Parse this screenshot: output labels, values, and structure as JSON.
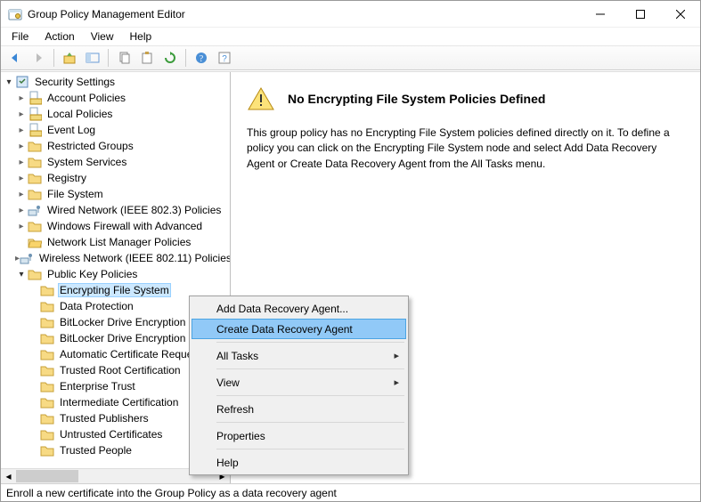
{
  "window": {
    "title": "Group Policy Management Editor"
  },
  "menubar": [
    "File",
    "Action",
    "View",
    "Help"
  ],
  "toolbar_icons": [
    "back-arrow-icon",
    "forward-arrow-icon",
    "up-folder-icon",
    "show-hide-tree-icon",
    "copy-icon",
    "paste-icon",
    "refresh-icon",
    "help-blue-icon",
    "help-toggle-icon"
  ],
  "tree": {
    "root": {
      "label": "Security Settings"
    },
    "nodes": [
      {
        "label": "Account Policies",
        "icon": "policy"
      },
      {
        "label": "Local Policies",
        "icon": "policy"
      },
      {
        "label": "Event Log",
        "icon": "policy"
      },
      {
        "label": "Restricted Groups",
        "icon": "folder"
      },
      {
        "label": "System Services",
        "icon": "folder"
      },
      {
        "label": "Registry",
        "icon": "folder"
      },
      {
        "label": "File System",
        "icon": "folder"
      },
      {
        "label": "Wired Network (IEEE 802.3) Policies",
        "icon": "net"
      },
      {
        "label": "Windows Firewall with Advanced",
        "icon": "folder"
      },
      {
        "label": "Network List Manager Policies",
        "icon": "folder-open"
      },
      {
        "label": "Wireless Network (IEEE 802.11) Policies",
        "icon": "net"
      }
    ],
    "pkp": {
      "label": "Public Key Policies"
    },
    "pkp_children": [
      {
        "label": "Encrypting File System",
        "selected": true
      },
      {
        "label": "Data Protection"
      },
      {
        "label": "BitLocker Drive Encryption"
      },
      {
        "label": "BitLocker Drive Encryption Network"
      },
      {
        "label": "Automatic Certificate Request"
      },
      {
        "label": "Trusted Root Certification"
      },
      {
        "label": "Enterprise Trust"
      },
      {
        "label": "Intermediate Certification"
      },
      {
        "label": "Trusted Publishers"
      },
      {
        "label": "Untrusted Certificates"
      },
      {
        "label": "Trusted People"
      }
    ]
  },
  "content": {
    "heading": "No Encrypting File System Policies Defined",
    "body": "This group policy has no Encrypting File System policies defined directly on it.  To define a policy you can click on the Encrypting File System node and select Add Data Recovery Agent or Create Data Recovery Agent from the All Tasks menu."
  },
  "context_menu": {
    "items": [
      {
        "label": "Add Data Recovery Agent...",
        "type": "item"
      },
      {
        "label": "Create Data Recovery Agent",
        "type": "item",
        "hover": true
      },
      {
        "type": "sep"
      },
      {
        "label": "All Tasks",
        "type": "sub"
      },
      {
        "type": "sep"
      },
      {
        "label": "View",
        "type": "sub"
      },
      {
        "type": "sep"
      },
      {
        "label": "Refresh",
        "type": "item"
      },
      {
        "type": "sep"
      },
      {
        "label": "Properties",
        "type": "item"
      },
      {
        "type": "sep"
      },
      {
        "label": "Help",
        "type": "item"
      }
    ]
  },
  "statusbar": "Enroll a new certificate into the Group Policy as a data recovery agent"
}
